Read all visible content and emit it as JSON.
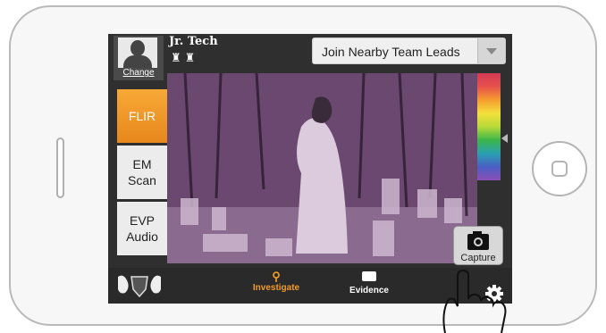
{
  "header": {
    "avatar_label": "Change",
    "rank_title": "Jr. Tech",
    "team_dropdown": "Join Nearby Team Leads"
  },
  "modes": [
    "FLIR",
    "EM Scan",
    "EVP Audio"
  ],
  "camera": {
    "capture_label": "Capture"
  },
  "footer": {
    "tabs": [
      "Investigate",
      "Evidence"
    ],
    "active_tab": "Investigate"
  },
  "colors": {
    "accent": "#f29b25",
    "thermal_tint": "#6e4b73",
    "screen_bg": "#2f2f2f"
  },
  "icons": [
    "user-avatar-icon",
    "badge-icon",
    "dropdown-arrow-icon",
    "camera-icon",
    "search-icon",
    "evidence-icon",
    "gear-icon",
    "crest-logo",
    "hand-pointer-icon"
  ]
}
